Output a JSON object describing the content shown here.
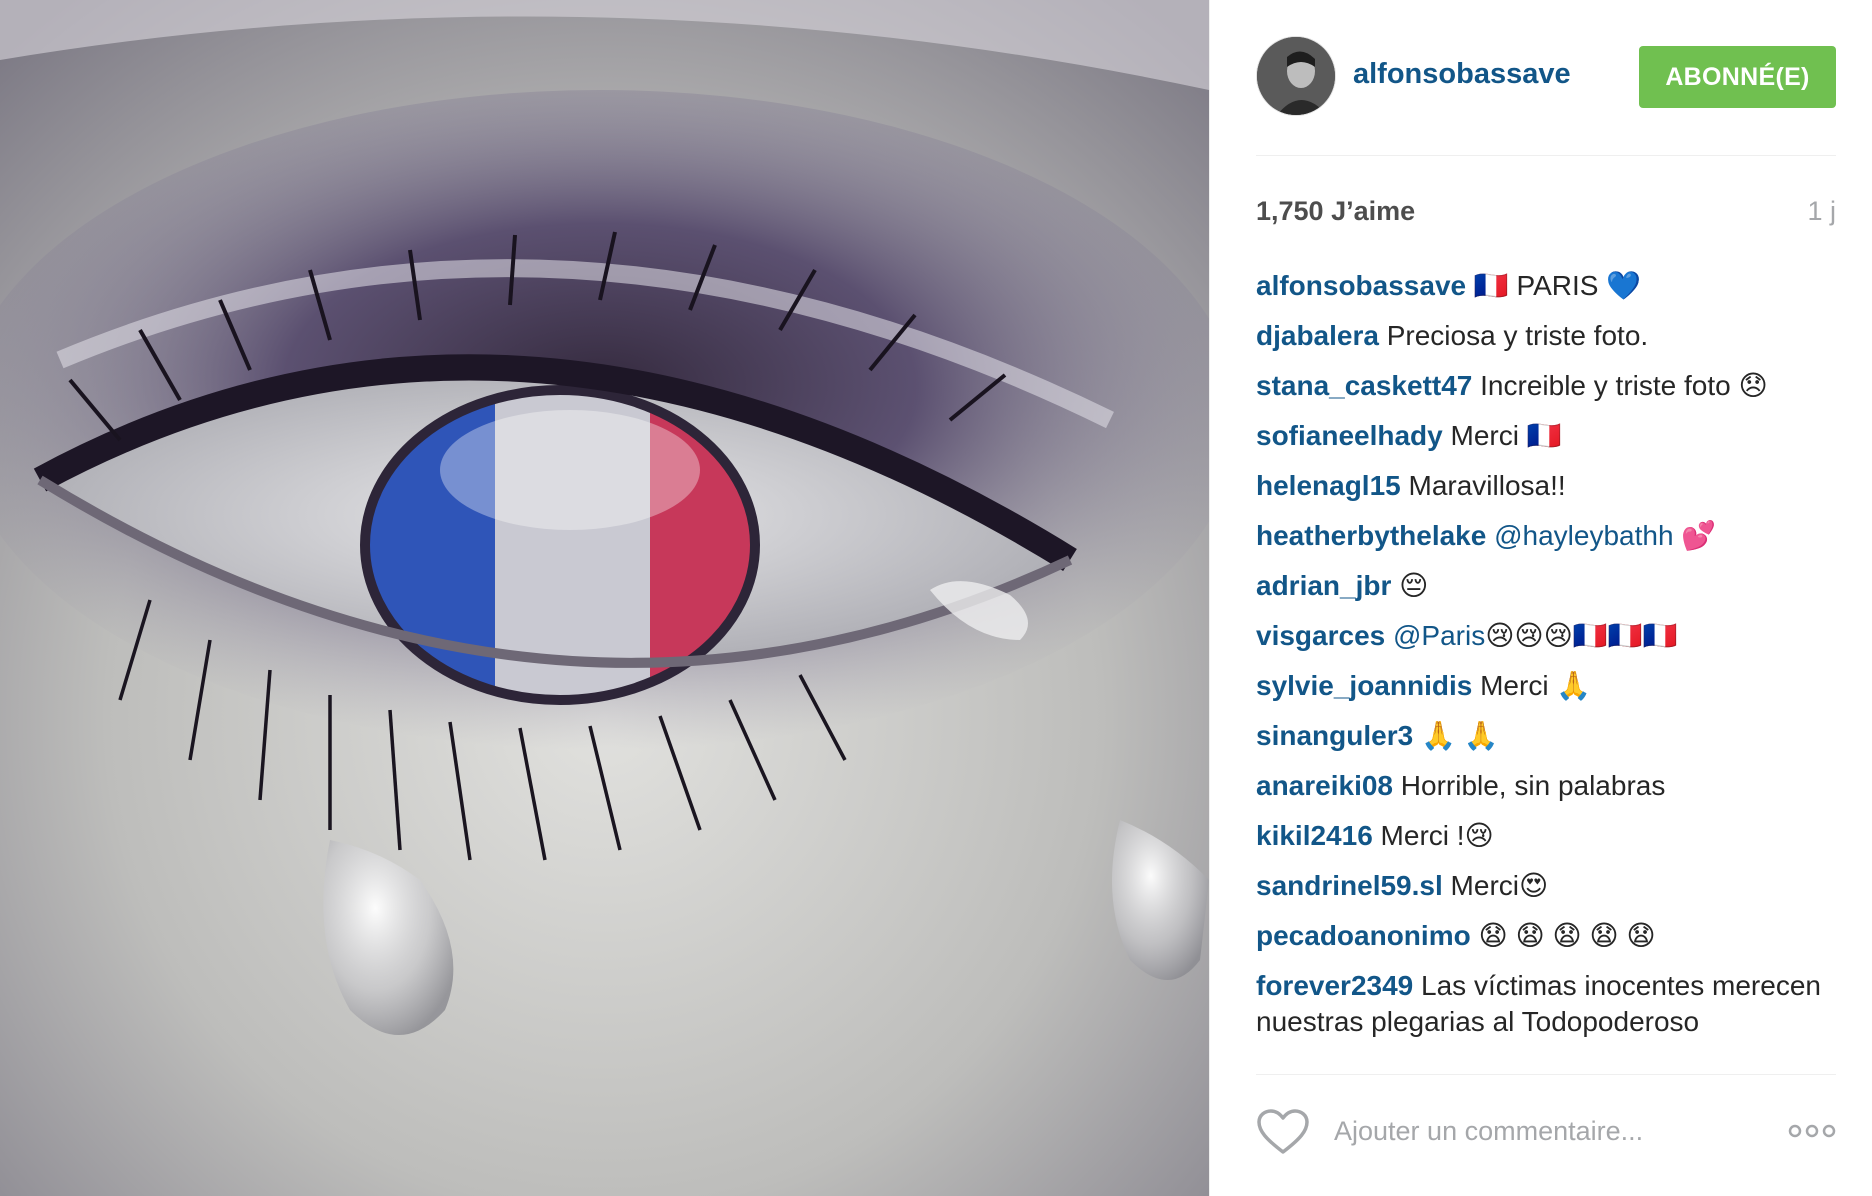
{
  "post": {
    "image_alt": "Eye with French flag iris shedding a tear",
    "colors": {
      "flag_blue": "#2f55b8",
      "flag_white": "#c9c9d2",
      "flag_red": "#c7385a",
      "eyeshadow": "#5c4d7a"
    }
  },
  "header": {
    "username": "alfonsobassave",
    "follow_label": "ABONNÉ(E)",
    "follow_color": "#70c050",
    "avatar_icon": "avatar-photo"
  },
  "stats": {
    "likes": "1,750 J’aime",
    "time": "1 j"
  },
  "comments": [
    {
      "author": "alfonsobassave",
      "text": " 🇫🇷 PARIS 💙"
    },
    {
      "author": "djabalera",
      "text": " Preciosa y triste foto."
    },
    {
      "author": "stana_caskett47",
      "text": " Increible y triste foto 😞"
    },
    {
      "author": "sofianeelhady",
      "text": " Merci 🇫🇷"
    },
    {
      "author": "helenagl15",
      "text": " Maravillosa!!"
    },
    {
      "author": "heatherbythelake",
      "mention": " @hayleybathh",
      "text": " 💕"
    },
    {
      "author": "adrian_jbr",
      "text": " 😔"
    },
    {
      "author": "visgarces",
      "mention": " @Paris",
      "text": "😢😢😢🇫🇷🇫🇷🇫🇷"
    },
    {
      "author": "sylvie_joannidis",
      "text": " Merci 🙏"
    },
    {
      "author": "sinanguler3",
      "text": " 🙏 🙏"
    },
    {
      "author": "anareiki08",
      "text": " Horrible, sin palabras"
    },
    {
      "author": "kikil2416",
      "text": " Merci !😢"
    },
    {
      "author": "sandrinel59.sl",
      "text": " Merci😍"
    },
    {
      "author": "pecadoanonimo",
      "text": " 😧 😧 😧 😧 😧"
    },
    {
      "author": "forever2349",
      "text": " Las víctimas inocentes merecen nuestras plegarias al Todopoderoso"
    }
  ],
  "footer": {
    "like_icon": "heart-outline-icon",
    "comment_placeholder": "Ajouter un commentaire...",
    "more_icon": "ellipsis-icon"
  }
}
